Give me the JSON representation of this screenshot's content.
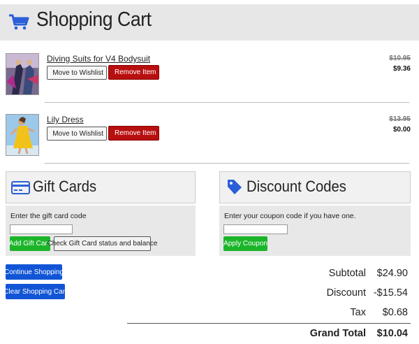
{
  "header": {
    "title": "Shopping Cart",
    "icon": "shopping-cart-icon",
    "accent": "#2b5fd9"
  },
  "items": [
    {
      "title": "Diving Suits for V4 Bodysuit",
      "wishlist_label": "Move to Wishlist",
      "remove_label": "Remove Item",
      "old_price": "$10.95",
      "new_price": "$9.36"
    },
    {
      "title": "Lily Dress",
      "wishlist_label": "Move to Wishlist",
      "remove_label": "Remove Item",
      "old_price": "$13.95",
      "new_price": "$0.00"
    }
  ],
  "gift_cards": {
    "title": "Gift Cards",
    "icon": "credit-card-icon",
    "prompt": "Enter the gift card code",
    "input_value": "",
    "add_label": "Add Gift Card",
    "check_label": "Check Gift Card status and balance"
  },
  "discount": {
    "title": "Discount Codes",
    "icon": "tag-icon",
    "prompt": "Enter your coupon code if you have one.",
    "input_value": "",
    "apply_label": "Apply Coupon"
  },
  "actions": {
    "continue_label": "Continue Shopping",
    "clear_label": "Clear Shopping Cart"
  },
  "summary": {
    "subtotal_label": "Subtotal",
    "subtotal": "$24.90",
    "discount_label": "Discount",
    "discount": "-$15.54",
    "tax_label": "Tax",
    "tax": "$0.68",
    "grand_total_label": "Grand Total",
    "grand_total": "$10.04"
  },
  "colors": {
    "remove": "#b80f0f",
    "green": "#1bb52a",
    "blue": "#1155d6",
    "icon_blue": "#2b5fd9"
  }
}
